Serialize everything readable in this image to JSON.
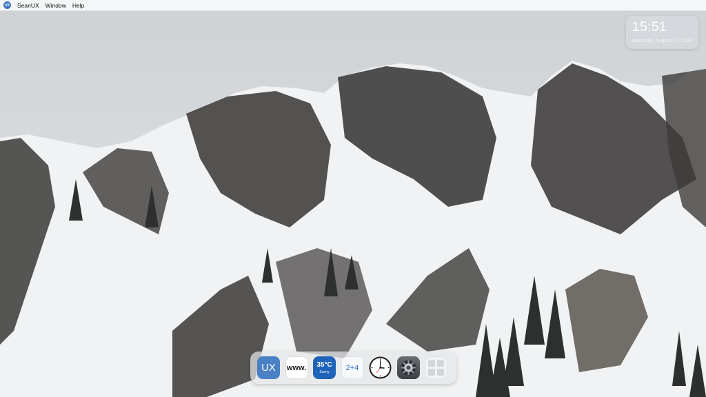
{
  "menubar": {
    "logo_text": "UX",
    "items": [
      "SeanUX",
      "Window",
      "Help"
    ]
  },
  "clock_widget": {
    "time": "15:51",
    "date": "Saturday, August 17, 2024"
  },
  "dock": {
    "apps": [
      {
        "name": "SeanUX",
        "label": "UX"
      },
      {
        "name": "Browser",
        "label": "www."
      },
      {
        "name": "Weather",
        "temp": "35°C",
        "condition": "Sunny"
      },
      {
        "name": "Calculator",
        "label": "2+4"
      },
      {
        "name": "Clock",
        "icon": "analog-clock-icon"
      },
      {
        "name": "Settings",
        "icon": "gear-icon"
      },
      {
        "name": "Launchpad",
        "icon": "app-grid-icon"
      }
    ]
  },
  "colors": {
    "accent": "#4a80c4",
    "weather_bg": "#1e63b9"
  }
}
